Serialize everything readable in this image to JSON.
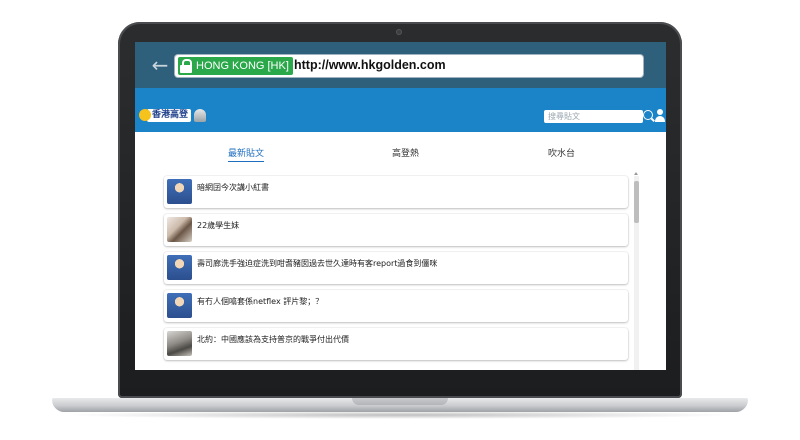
{
  "browser": {
    "ev_label": "HONG KONG  [HK]",
    "url": "http://www.hkgolden.com"
  },
  "site": {
    "logo_text": "香港高登",
    "search_placeholder": "搜尋貼文"
  },
  "tabs": [
    {
      "label": "最新貼文",
      "active": true
    },
    {
      "label": "高登熱",
      "active": false
    },
    {
      "label": "吹水台",
      "active": false
    }
  ],
  "posts": [
    {
      "title": "暗網囝今次講小紅書",
      "thumb": "cartoon-avatar"
    },
    {
      "title": "22歲學生妹",
      "thumb": "photo"
    },
    {
      "title": "壽司廊洗手強迫症洗到咁耆豬囡過去世久達時有客report過食到僵咪",
      "thumb": "cartoon-avatar"
    },
    {
      "title": "有冇人個噏套係netflex 評片黎；？",
      "thumb": "cartoon-avatar"
    },
    {
      "title": "北約：中國應該為支持普京的戰爭付出代價",
      "thumb": "photo"
    }
  ]
}
